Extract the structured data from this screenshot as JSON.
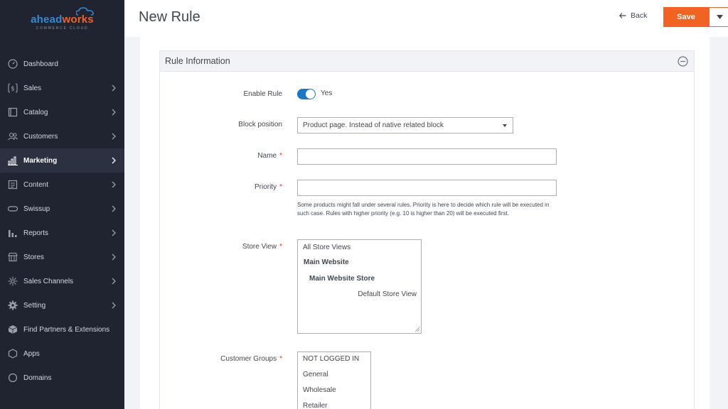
{
  "logo": {
    "part1": "ahead",
    "part2": "works",
    "tagline": "COMMERCE CLOUD"
  },
  "sidebar": {
    "items": [
      {
        "label": "Dashboard",
        "icon": "dashboard-icon",
        "chevron": false,
        "active": false
      },
      {
        "label": "Sales",
        "icon": "dollar-icon",
        "chevron": true,
        "active": false
      },
      {
        "label": "Catalog",
        "icon": "catalog-icon",
        "chevron": true,
        "active": false
      },
      {
        "label": "Customers",
        "icon": "customers-icon",
        "chevron": true,
        "active": false
      },
      {
        "label": "Marketing",
        "icon": "marketing-icon",
        "chevron": true,
        "active": true
      },
      {
        "label": "Content",
        "icon": "content-icon",
        "chevron": true,
        "active": false
      },
      {
        "label": "Swissup",
        "icon": "swissup-icon",
        "chevron": true,
        "active": false
      },
      {
        "label": "Reports",
        "icon": "reports-icon",
        "chevron": true,
        "active": false
      },
      {
        "label": "Stores",
        "icon": "stores-icon",
        "chevron": true,
        "active": false
      },
      {
        "label": "Sales Channels",
        "icon": "sales-channels-icon",
        "chevron": true,
        "active": false
      },
      {
        "label": "Setting",
        "icon": "gear-icon",
        "chevron": true,
        "active": false
      },
      {
        "label": "Find Partners & Extensions",
        "icon": "extensions-icon",
        "chevron": false,
        "active": false
      },
      {
        "label": "Apps",
        "icon": "apps-icon",
        "chevron": false,
        "active": false
      },
      {
        "label": "Domains",
        "icon": "domains-icon",
        "chevron": false,
        "active": false
      }
    ]
  },
  "header": {
    "title": "New Rule",
    "back_label": "Back",
    "save_label": "Save"
  },
  "section": {
    "title": "Rule Information"
  },
  "form": {
    "enable_rule": {
      "label": "Enable Rule",
      "value": "Yes"
    },
    "block_position": {
      "label": "Block position",
      "value": "Product page. Instead of native related block"
    },
    "name": {
      "label": "Name",
      "required": "*",
      "value": ""
    },
    "priority": {
      "label": "Priority",
      "required": "*",
      "value": "",
      "note": "Some products might fall under several rules. Priority is here to decide which rule will be executed in such case. Rules with higher priority (e.g. 10 is higher than 20) will be executed first."
    },
    "store_view": {
      "label": "Store View",
      "required": "*",
      "options": [
        "All Store Views",
        "Main Website",
        "Main Website Store",
        "Default Store View"
      ]
    },
    "customer_groups": {
      "label": "Customer Groups",
      "required": "*",
      "options": [
        "NOT LOGGED IN",
        "General",
        "Wholesale",
        "Retailer"
      ]
    }
  },
  "colors": {
    "accent": "#f26322",
    "sidebar_bg": "#1f2430",
    "toggle_on": "#1979c3"
  }
}
